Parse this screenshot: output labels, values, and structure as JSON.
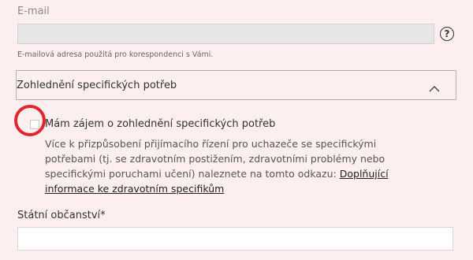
{
  "email": {
    "label": "E-mail",
    "value": "",
    "help_icon": "question-circle-icon",
    "hint": "E-mailová adresa použitá pro korespondenci s Vámi."
  },
  "special_needs": {
    "title": "Zohlednění specifických potřeb",
    "toggle_icon": "chevron-up-icon",
    "checkbox_label": "Mám zájem o zohlednění specifických potřeb",
    "checked": false,
    "description": "Více k přizpůsobení přijímacího řízení pro uchazeče se specifickými potřebami (tj. se zdravotním postižením, zdravotními problémy nebo specifickými poruchami učení) naleznete na tomto odkazu:",
    "link_text": "Doplňující informace ke zdravotním specifikům"
  },
  "citizenship": {
    "label": "Státní občanství*",
    "value": ""
  },
  "colors": {
    "background": "#fdeef0",
    "annotation_circle": "#e1262e"
  }
}
